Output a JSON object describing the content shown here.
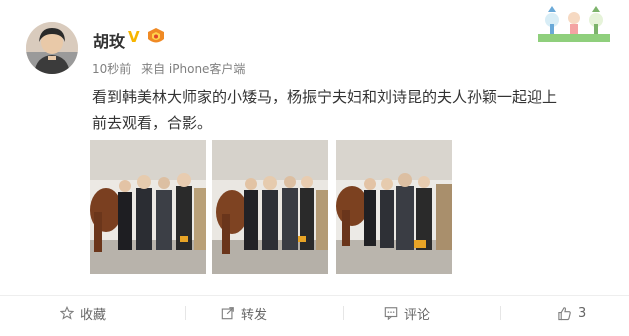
{
  "post": {
    "author": "胡玫",
    "verified_mark": "V",
    "time": "10秒前",
    "source": "来自 iPhone客户端",
    "text": "看到韩美林大师家的小矮马，杨振宁夫妇和刘诗昆的夫人孙颖一起迎上前去观看，合影。"
  },
  "actions": {
    "favorite_label": "收藏",
    "repost_label": "转发",
    "comment_label": "评论",
    "like_count": "3"
  },
  "colors": {
    "verified": "#f7b500",
    "text": "#333333",
    "meta": "#808080",
    "action": "#666666"
  },
  "icons": [
    "star-icon",
    "share-icon",
    "comment-icon",
    "thumb-up-icon",
    "medal-icon"
  ]
}
